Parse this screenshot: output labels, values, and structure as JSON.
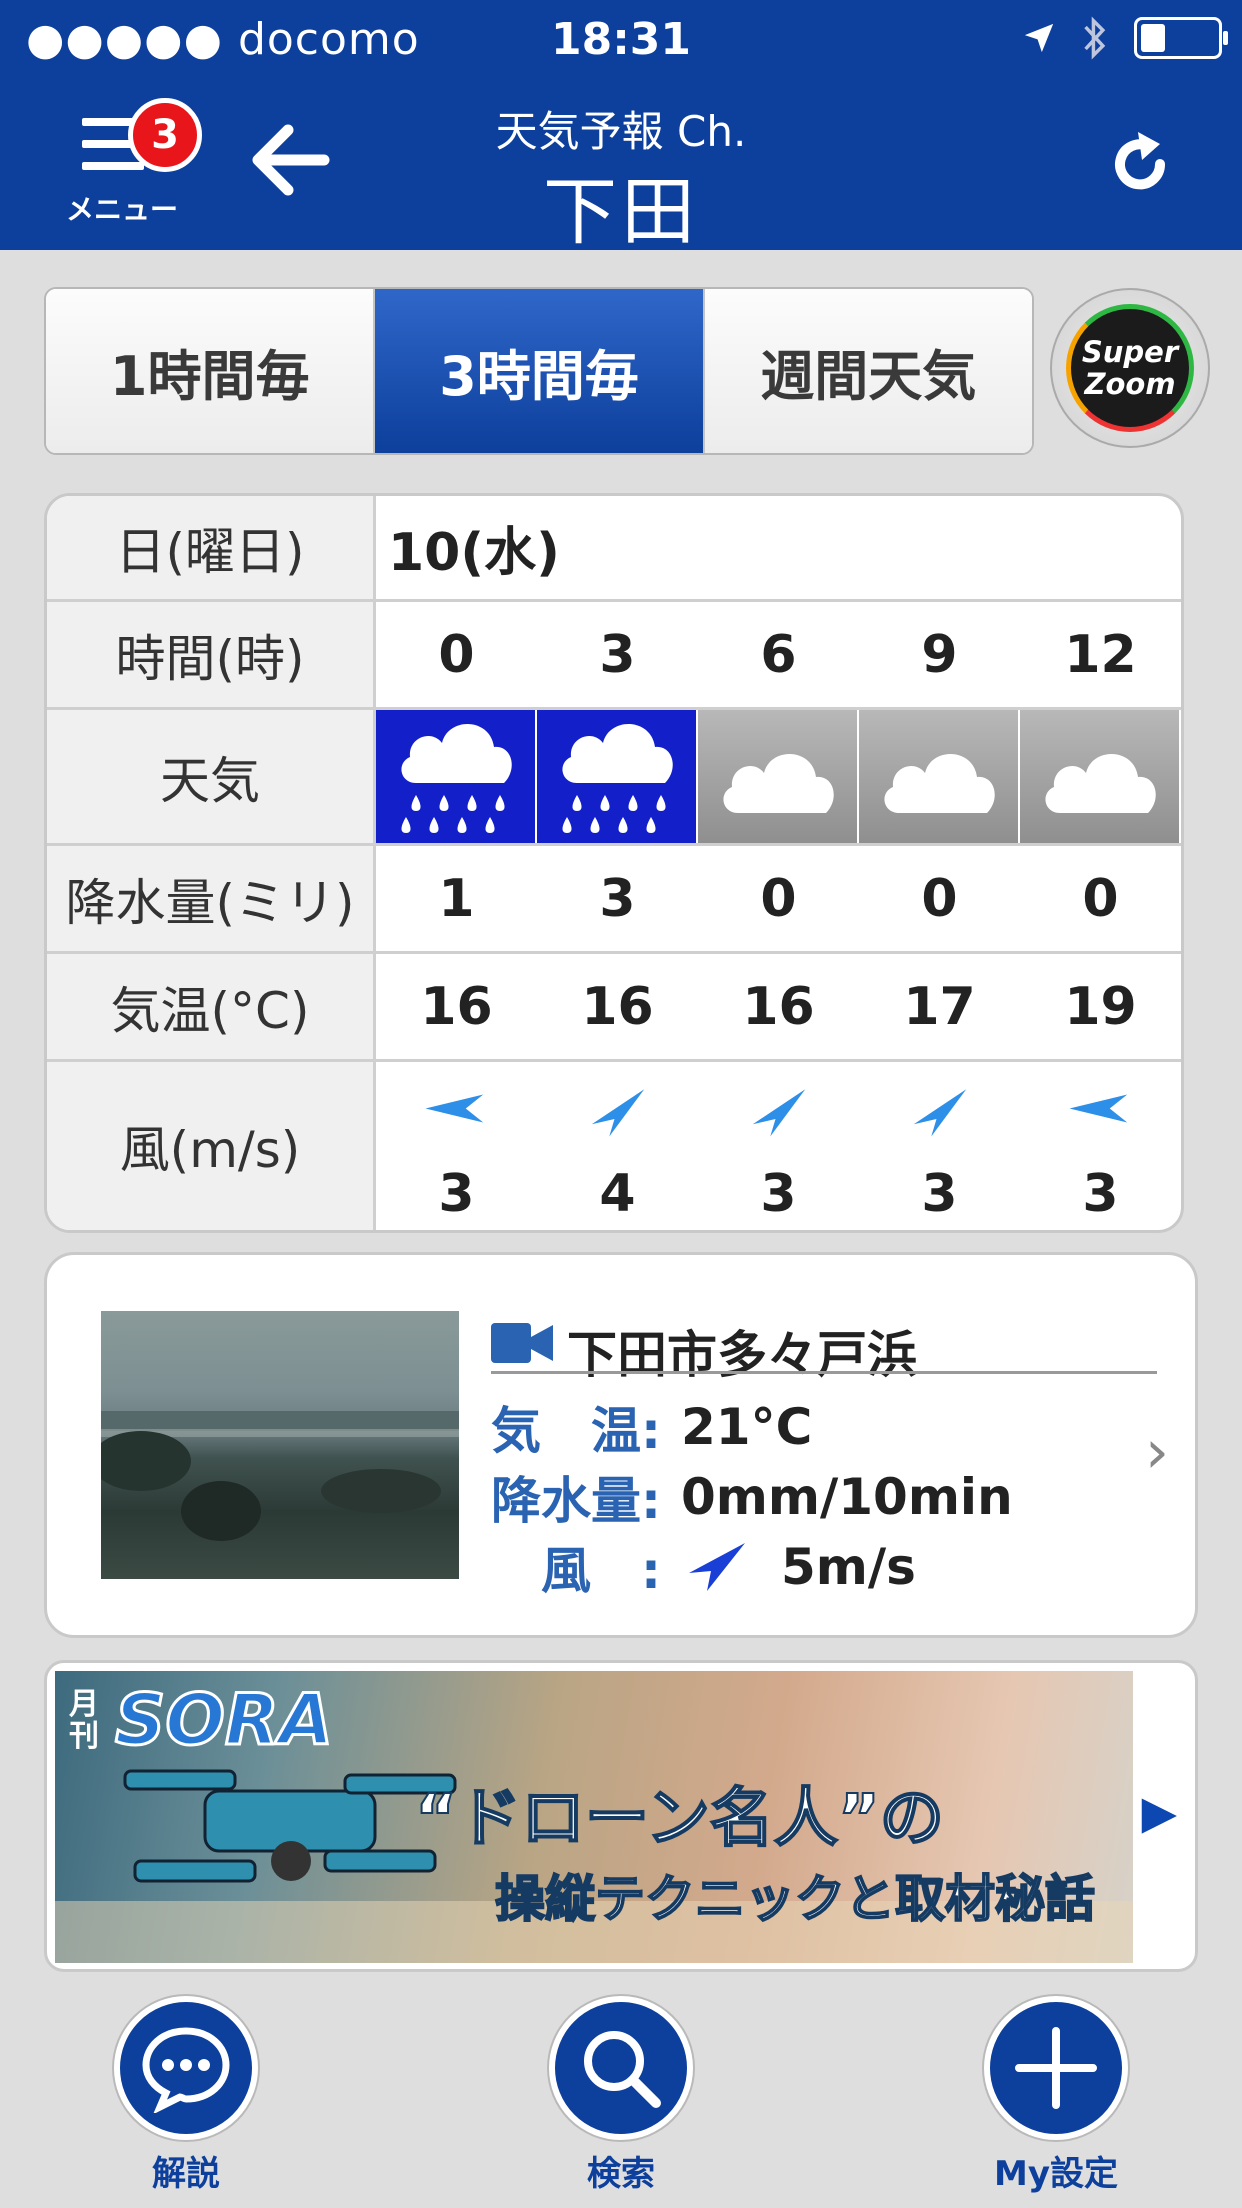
{
  "status_bar": {
    "carrier": "●●●●● docomo",
    "time": "18:31"
  },
  "header": {
    "menu_label": "メニュー",
    "menu_badge": "3",
    "subtitle": "天気予報 Ch.",
    "title": "下田"
  },
  "tabs": [
    {
      "label": "1時間毎",
      "active": false
    },
    {
      "label": "3時間毎",
      "active": true
    },
    {
      "label": "週間天気",
      "active": false
    }
  ],
  "super_zoom": {
    "line1": "Super",
    "line2": "Zoom"
  },
  "forecast": {
    "date_label": "日(曜日)",
    "date_value": "10(水)",
    "hour_label": "時間(時)",
    "hours": [
      "0",
      "3",
      "6",
      "9",
      "12"
    ],
    "weather_label": "天気",
    "weather": [
      "rain",
      "rain",
      "cloudy",
      "cloudy",
      "cloudy"
    ],
    "precip_label": "降水量(ミリ)",
    "precip": [
      "1",
      "3",
      "0",
      "0",
      "0"
    ],
    "temp_label": "気温(°C)",
    "temps": [
      "16",
      "16",
      "16",
      "17",
      "19"
    ],
    "wind_label": "風(m/s)",
    "wind_speeds": [
      "3",
      "4",
      "3",
      "3",
      "3"
    ],
    "wind_directions": [
      "east",
      "north-east",
      "north-east",
      "north-east",
      "east"
    ]
  },
  "camera": {
    "title": "下田市多々戸浜",
    "temp_key": "気　温:",
    "temp_value": "21°C",
    "precip_key": "降水量:",
    "precip_value": "0mm/10min",
    "wind_key": "風　:",
    "wind_value": "5m/s"
  },
  "banner": {
    "monthly": "月刊",
    "brand": "SORA",
    "line1": "“ドローン名人”の",
    "line2": "操縦テクニックと取材秘話"
  },
  "bottom_nav": [
    {
      "label": "解説",
      "icon": "chat-bubble-icon"
    },
    {
      "label": "検索",
      "icon": "search-icon"
    },
    {
      "label": "My設定",
      "icon": "plus-icon"
    }
  ],
  "colors": {
    "brand_blue": "#0d3f9c",
    "rain_blue": "#1320c9",
    "badge_red": "#e8151b"
  }
}
